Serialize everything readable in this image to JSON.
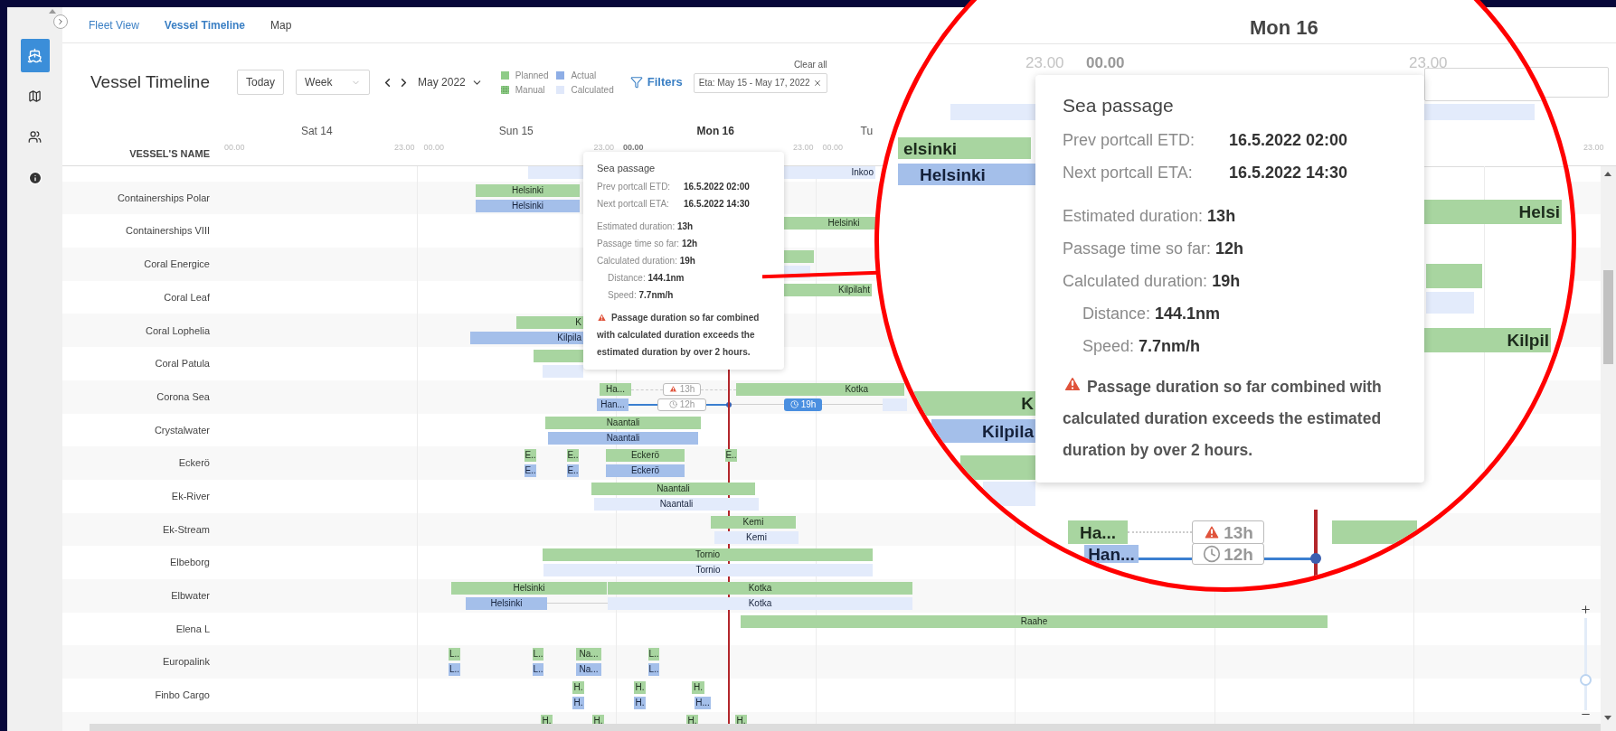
{
  "sidebar": {
    "items": [
      {
        "kind": "ships",
        "selected": true
      },
      {
        "kind": "map",
        "selected": false
      },
      {
        "kind": "people",
        "selected": false
      },
      {
        "kind": "info",
        "selected": false
      }
    ]
  },
  "nav": {
    "tabs": [
      {
        "label": "Fleet View",
        "selected": false
      },
      {
        "label": "Vessel Timeline",
        "selected": true
      },
      {
        "label": "Map",
        "selected": false
      }
    ]
  },
  "toolbar": {
    "title": "Vessel Timeline",
    "today": "Today",
    "view": "Week",
    "month": "May 2022",
    "legend": [
      {
        "kind": "planned",
        "label": "Planned"
      },
      {
        "kind": "manual",
        "label": "Manual"
      },
      {
        "kind": "actual",
        "label": "Actual"
      },
      {
        "kind": "calculated",
        "label": "Calculated"
      }
    ],
    "filters": "Filters",
    "clear_all": "Clear all",
    "filter_chip": "Eta: May 15 - May 17, 2022"
  },
  "header": {
    "column": "VESSEL'S NAME",
    "days": [
      {
        "label": "Sat 14",
        "selected": false,
        "start_hour": "00.00",
        "end_hour": "23.00"
      },
      {
        "label": "Sun 15",
        "selected": false,
        "start_hour": "00.00",
        "end_hour": "23.00"
      },
      {
        "label": "Mon 16",
        "selected": true,
        "start_hour": "00.00",
        "end_hour": "23.00"
      },
      {
        "label": "Tu",
        "selected": false,
        "start_hour": "00.00"
      }
    ],
    "edge_hour": "23.00"
  },
  "rows": [
    {
      "bars": [
        {
          "kind": "calculated",
          "label": "Inkoo"
        }
      ]
    },
    {
      "name": "Containerships Polar",
      "bars": [
        {
          "kind": "planned",
          "label": "Helsinki"
        },
        {
          "kind": "actual",
          "label": "Helsinki"
        }
      ]
    },
    {
      "name": "Containerships VIII",
      "bars": [
        {
          "kind": "planned",
          "label": "Helsinki"
        }
      ]
    },
    {
      "name": "Coral Energice",
      "bars": [
        {
          "kind": "planned"
        },
        {
          "kind": "calculated"
        }
      ]
    },
    {
      "name": "Coral Leaf",
      "bars": [
        {
          "kind": "planned",
          "label": "Kilpilaht"
        }
      ]
    },
    {
      "name": "Coral Lophelia",
      "bars": [
        {
          "kind": "planned",
          "label": "K"
        },
        {
          "kind": "actual",
          "label": "Kilpila"
        }
      ]
    },
    {
      "name": "Coral Patula",
      "bars": [
        {
          "kind": "planned"
        },
        {
          "kind": "calculated"
        }
      ]
    },
    {
      "name": "Corona Sea",
      "bars": [
        {
          "kind": "planned",
          "label": "Ha..."
        },
        {
          "kind": "warning_chip",
          "label": "13h"
        },
        {
          "kind": "planned",
          "label": "Kotka"
        },
        {
          "kind": "actual",
          "label": "Han..."
        },
        {
          "kind": "elapsed_chip",
          "label": "12h"
        },
        {
          "kind": "estimate_chip",
          "label": "19h"
        },
        {
          "kind": "calculated"
        }
      ]
    },
    {
      "name": "Crystalwater",
      "bars": [
        {
          "kind": "planned",
          "label": "Naantali"
        },
        {
          "kind": "actual",
          "label": "Naantali"
        }
      ]
    },
    {
      "name": "Eckerö",
      "bars": [
        {
          "kind": "planned",
          "label": "E.."
        },
        {
          "kind": "planned",
          "label": "E.."
        },
        {
          "kind": "planned",
          "label": "Eckerö"
        },
        {
          "kind": "planned",
          "label": "E.."
        },
        {
          "kind": "actual",
          "label": "E.."
        },
        {
          "kind": "actual",
          "label": "E.."
        },
        {
          "kind": "actual",
          "label": "Eckerö"
        }
      ]
    },
    {
      "name": "Ek-River",
      "bars": [
        {
          "kind": "planned",
          "label": "Naantali"
        },
        {
          "kind": "calculated",
          "label": "Naantali"
        }
      ]
    },
    {
      "name": "Ek-Stream",
      "bars": [
        {
          "kind": "planned",
          "label": "Kemi"
        },
        {
          "kind": "calculated",
          "label": "Kemi"
        }
      ]
    },
    {
      "name": "Elbeborg",
      "bars": [
        {
          "kind": "planned",
          "label": "Tornio"
        },
        {
          "kind": "calculated",
          "label": "Tornio"
        }
      ]
    },
    {
      "name": "Elbwater",
      "bars": [
        {
          "kind": "planned",
          "label": "Helsinki"
        },
        {
          "kind": "planned",
          "label": "Kotka"
        },
        {
          "kind": "actual",
          "label": "Helsinki"
        },
        {
          "kind": "calculated",
          "label": "Kotka"
        }
      ]
    },
    {
      "name": "Elena L",
      "bars": [
        {
          "kind": "planned",
          "label": "Raahe"
        }
      ]
    },
    {
      "name": "Europalink",
      "bars": [
        {
          "kind": "planned",
          "label": "L.."
        },
        {
          "kind": "planned",
          "label": "L.."
        },
        {
          "kind": "planned",
          "label": "Na..."
        },
        {
          "kind": "planned",
          "label": "L.."
        },
        {
          "kind": "actual",
          "label": "L.."
        },
        {
          "kind": "actual",
          "label": "L.."
        },
        {
          "kind": "actual",
          "label": "Na..."
        },
        {
          "kind": "actual",
          "label": "L.."
        }
      ]
    },
    {
      "name": "Finbo Cargo",
      "bars": [
        {
          "kind": "planned",
          "label": "H."
        },
        {
          "kind": "planned",
          "label": "H."
        },
        {
          "kind": "planned",
          "label": "H."
        },
        {
          "kind": "actual",
          "label": "H."
        },
        {
          "kind": "actual",
          "label": "H."
        },
        {
          "kind": "actual",
          "label": "H..."
        }
      ]
    },
    {
      "bars": [
        {
          "kind": "planned",
          "label": "H."
        },
        {
          "kind": "planned",
          "label": "H."
        },
        {
          "kind": "planned",
          "label": "H."
        },
        {
          "kind": "planned",
          "label": "H."
        }
      ]
    }
  ],
  "tooltip": {
    "title": "Sea passage",
    "portcalls": [
      {
        "label": "Prev portcall ETD:",
        "value": "16.5.2022 02:00"
      },
      {
        "label": "Next portcall ETA:",
        "value": "16.5.2022 14:30"
      }
    ],
    "durations": [
      {
        "label": "Estimated duration:",
        "value": "13h"
      },
      {
        "label": "Passage time so far:",
        "value": "12h"
      },
      {
        "label": "Calculated duration:",
        "value": "19h",
        "children": [
          {
            "label": "Distance:",
            "value": "144.1nm"
          },
          {
            "label": "Speed:",
            "value": "7.7nm/h"
          }
        ]
      }
    ],
    "warning": "Passage duration so far combined with calculated duration exceeds the estimated duration by over 2 hours."
  },
  "zoom": {
    "level": 0.3
  },
  "magnifier": {
    "day": "Mon 16",
    "hours": [
      {
        "label": "23.00",
        "bold": false
      },
      {
        "label": "00.00",
        "bold": true
      },
      {
        "label": "23.00",
        "bold": false
      }
    ],
    "tooltip": {
      "title": "Sea passage",
      "portcalls": [
        {
          "label": "Prev portcall ETD:",
          "value": "16.5.2022 02:00"
        },
        {
          "label": "Next portcall ETA:",
          "value": "16.5.2022 14:30"
        }
      ],
      "durations": [
        {
          "label": "Estimated duration:",
          "value": "13h"
        },
        {
          "label": "Passage time so far:",
          "value": "12h"
        },
        {
          "label": "Calculated duration:",
          "value": "19h",
          "children": [
            {
              "label": "Distance:",
              "value": "144.1nm"
            },
            {
              "label": "Speed:",
              "value": "7.7nm/h"
            }
          ]
        }
      ],
      "warning": "Passage duration so far combined with calculated duration exceeds the estimated duration by over 2 hours."
    },
    "bars": [
      {
        "kind": "planned",
        "label": "elsinki"
      },
      {
        "kind": "actual",
        "label": "Helsinki"
      },
      {
        "kind": "planned",
        "label": "Helsi"
      },
      {
        "kind": "planned"
      },
      {
        "kind": "calculated"
      },
      {
        "kind": "planned",
        "label": "Kilpil"
      },
      {
        "kind": "planned",
        "label": "K"
      },
      {
        "kind": "actual",
        "label": "Kilpila"
      },
      {
        "kind": "planned"
      },
      {
        "kind": "calculated"
      },
      {
        "kind": "planned",
        "label": "Ha..."
      },
      {
        "kind": "warning_chip",
        "label": "13h"
      },
      {
        "kind": "planned"
      },
      {
        "kind": "actual",
        "label": "Han..."
      },
      {
        "kind": "elapsed_chip",
        "label": "12h"
      }
    ]
  }
}
